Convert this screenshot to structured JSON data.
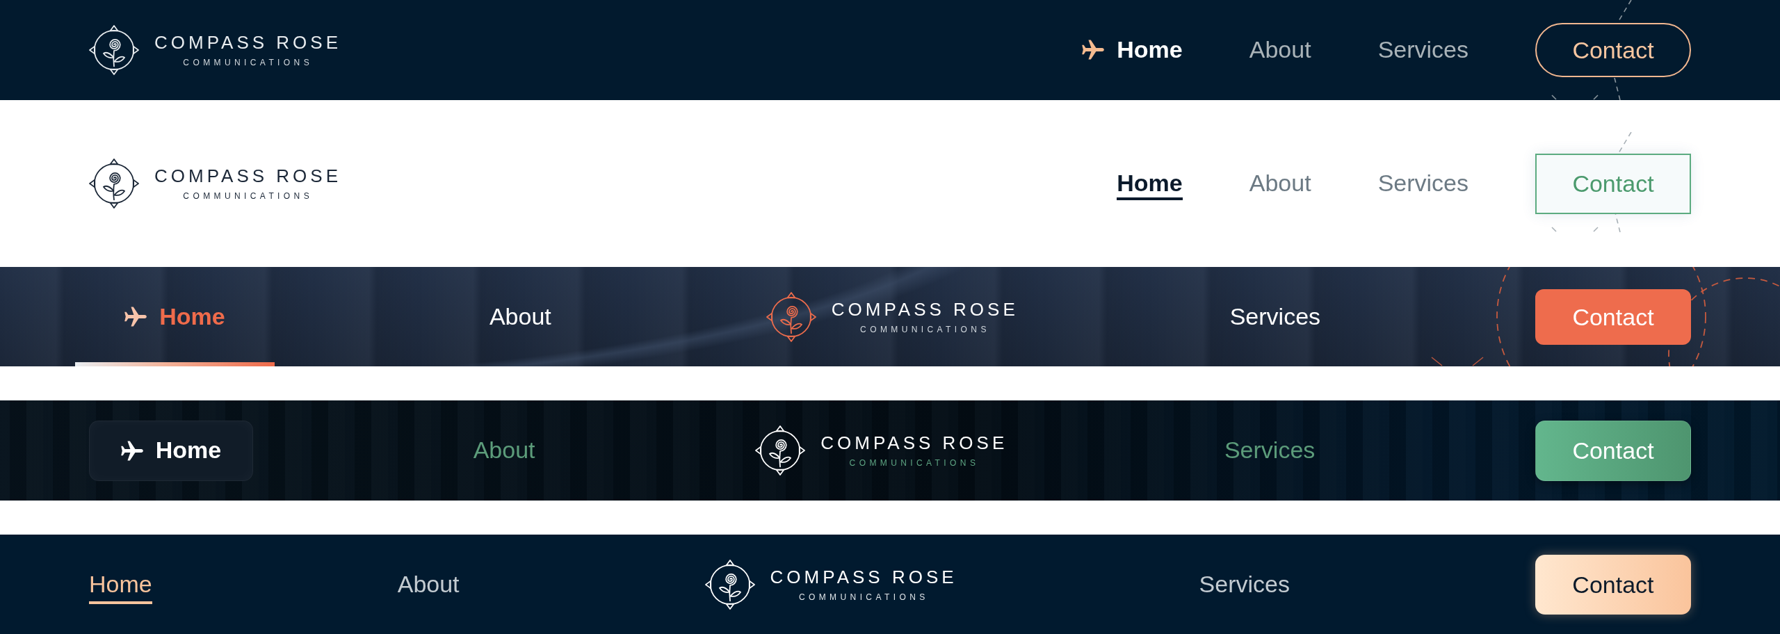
{
  "navbars": [
    {
      "kind": "classic",
      "logo": {
        "title": "COMPASS ROSE",
        "subtitle": "COMMUNICATIONS"
      },
      "links": [
        {
          "label": "Home",
          "selected": true
        },
        {
          "label": "About",
          "selected": false
        },
        {
          "label": "Services",
          "selected": false
        }
      ],
      "button": {
        "label": "Contact"
      }
    },
    {
      "kind": "light",
      "logo": {
        "title": "COMPASS ROSE",
        "subtitle": "COMMUNICATIONS"
      },
      "links": [
        {
          "label": "Home",
          "selected": true
        },
        {
          "label": "About",
          "selected": false
        },
        {
          "label": "Services",
          "selected": false
        }
      ],
      "button": {
        "label": "Contact"
      }
    },
    {
      "kind": "textured",
      "links_left": [
        {
          "label": "Home",
          "selected": true
        },
        {
          "label": "About",
          "selected": false
        }
      ],
      "logo": {
        "title": "COMPASS ROSE",
        "subtitle": "COMMUNICATIONS"
      },
      "links_right": [
        {
          "label": "Services",
          "selected": false
        }
      ],
      "button": {
        "label": "Contact"
      }
    },
    {
      "kind": "midnight",
      "links_left": [
        {
          "label": "Home",
          "selected": true
        },
        {
          "label": "About",
          "selected": false
        }
      ],
      "logo": {
        "title": "COMPASS ROSE",
        "subtitle": "COMMUNICATIONS"
      },
      "links_right": [
        {
          "label": "Services",
          "selected": false
        }
      ],
      "button": {
        "label": "Contact"
      }
    },
    {
      "kind": "minimal",
      "links_left": [
        {
          "label": "Home",
          "selected": true
        },
        {
          "label": "About",
          "selected": false
        }
      ],
      "logo": {
        "title": "COMPASS ROSE",
        "subtitle": "COMMUNICATIONS"
      },
      "links_right": [
        {
          "label": "Services",
          "selected": false
        }
      ],
      "button": {
        "label": "Contact"
      }
    }
  ]
}
